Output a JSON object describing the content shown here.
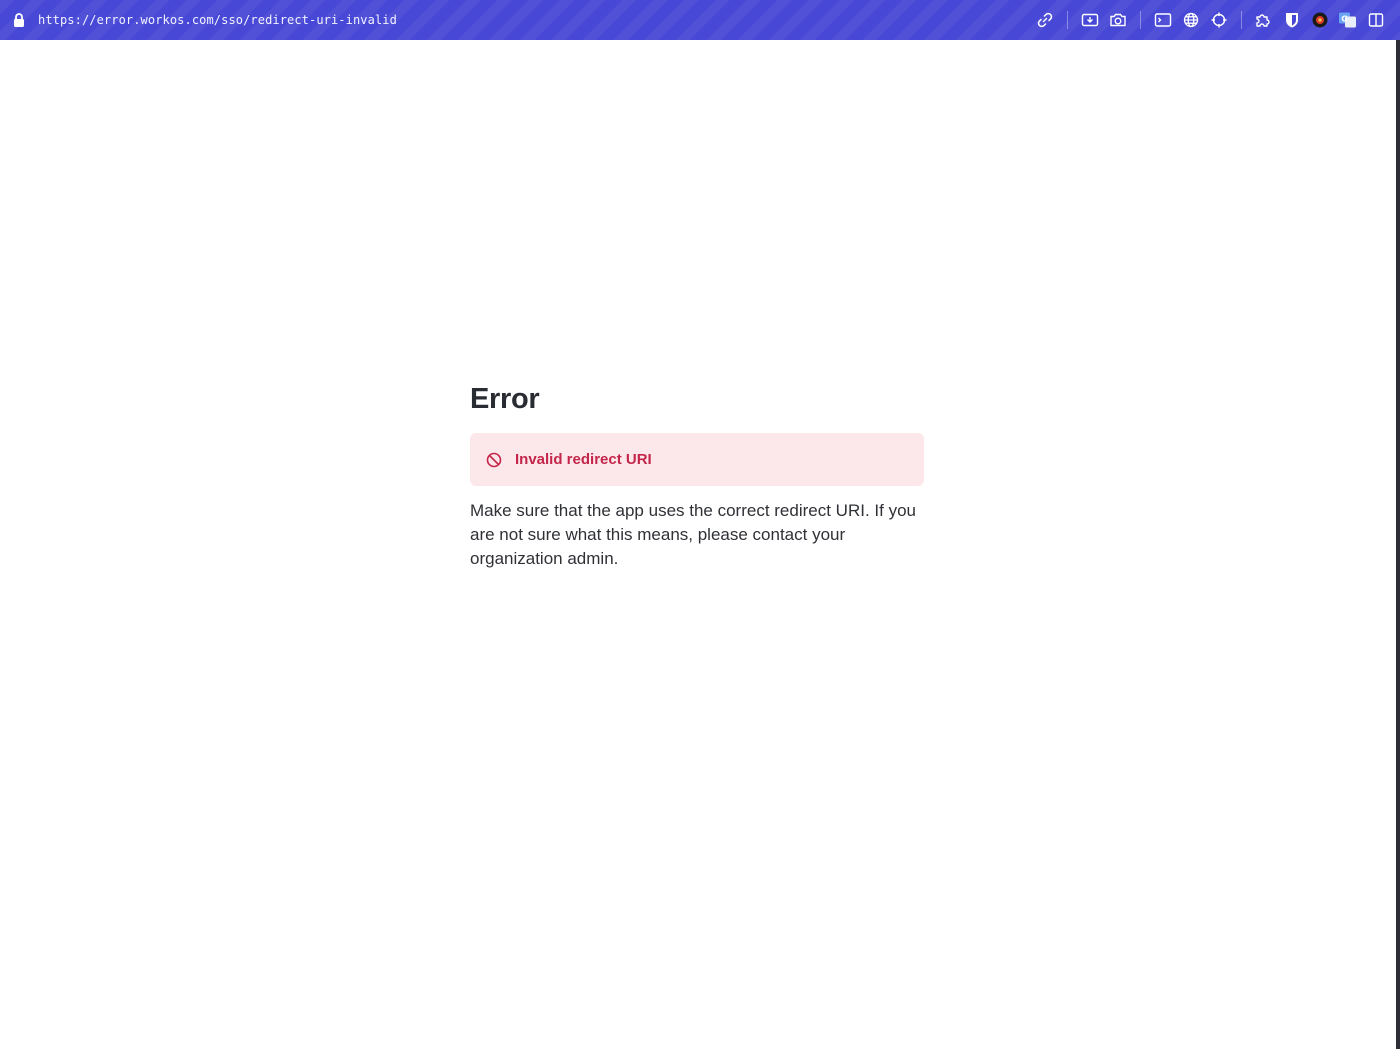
{
  "browser": {
    "url": "https://error.workos.com/sso/redirect-uri-invalid",
    "toolbar_icons": [
      "link-icon",
      "download-icon",
      "camera-icon",
      "terminal-icon",
      "globe-icon",
      "crosshair-icon",
      "puzzle-icon",
      "shield-icon",
      "extension-avatar-icon",
      "translate-icon",
      "sidebar-icon"
    ]
  },
  "page": {
    "title": "Error",
    "alert": {
      "text": "Invalid redirect URI",
      "icon": "block-icon",
      "color": "#c4254a",
      "background": "#fce8ea"
    },
    "message": "Make sure that the app uses the correct redirect URI. If you are not sure what this means, please contact your organization admin."
  },
  "colors": {
    "browser_bar": "#4848d6"
  }
}
